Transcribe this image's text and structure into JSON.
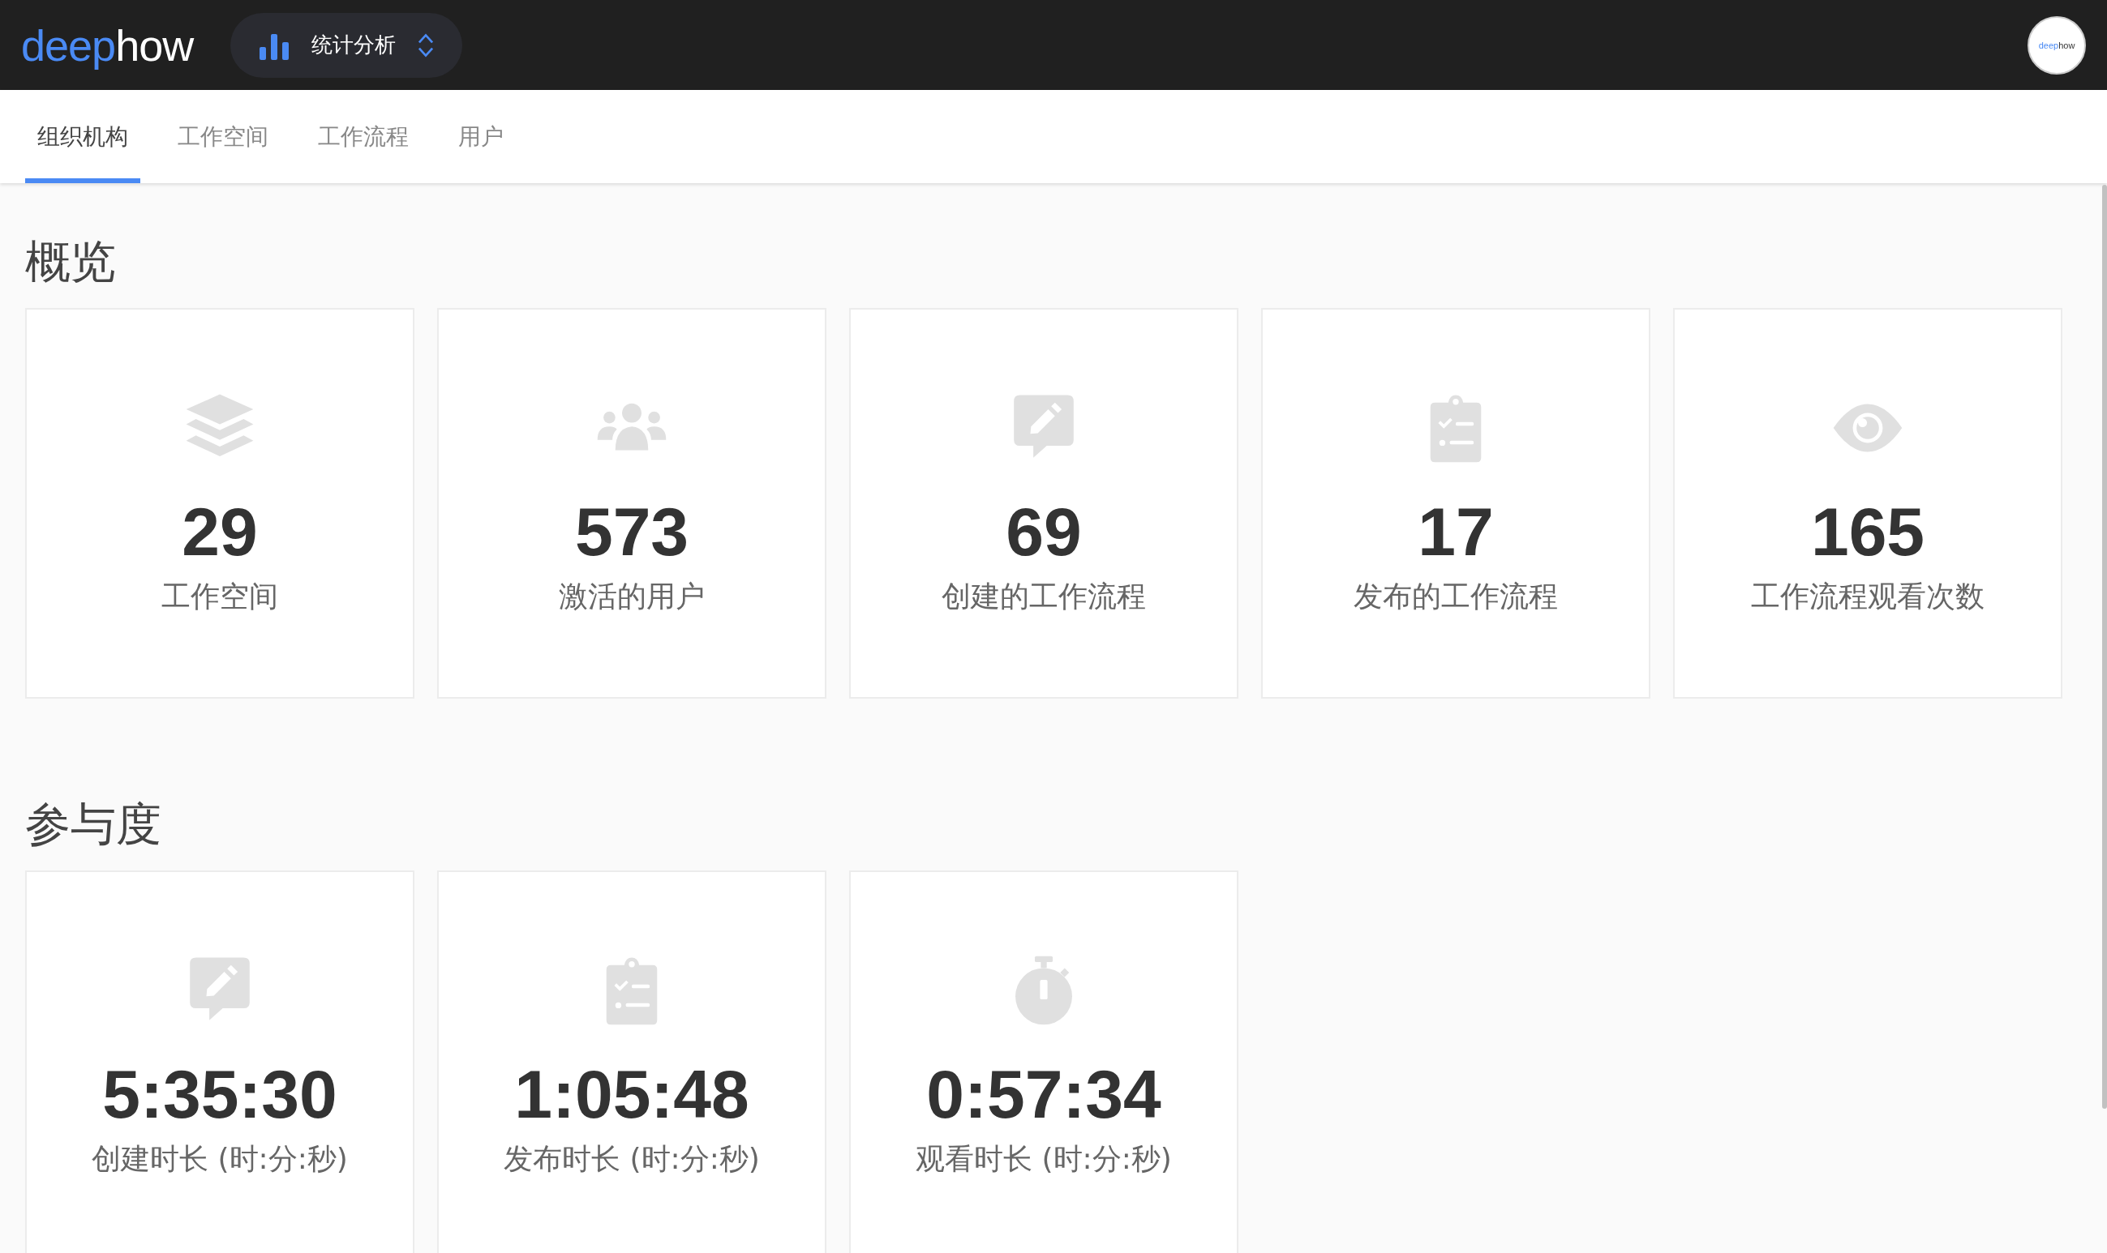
{
  "header": {
    "logo": {
      "part_1": "deep",
      "part_2": "how"
    },
    "switcher": {
      "label": "统计分析"
    },
    "avatar": {
      "part_1": "deep",
      "part_2": "how"
    }
  },
  "tabs": [
    {
      "label": "组织机构",
      "selected": true
    },
    {
      "label": "工作空间",
      "selected": false
    },
    {
      "label": "工作流程",
      "selected": false
    },
    {
      "label": "用户",
      "selected": false
    }
  ],
  "sections": [
    {
      "title": "概览",
      "cards": [
        {
          "kind": "layers",
          "value": "29",
          "label": "工作空间"
        },
        {
          "kind": "users",
          "value": "573",
          "label": "激活的用户"
        },
        {
          "kind": "edit",
          "value": "69",
          "label": "创建的工作流程"
        },
        {
          "kind": "checklist",
          "value": "17",
          "label": "发布的工作流程"
        },
        {
          "kind": "eye",
          "value": "165",
          "label": "工作流程观看次数"
        }
      ]
    },
    {
      "title": "参与度",
      "cards": [
        {
          "kind": "edit",
          "value": "5:35:30",
          "label": "创建时长 (时:分:秒)"
        },
        {
          "kind": "checklist",
          "value": "1:05:48",
          "label": "发布时长 (时:分:秒)"
        },
        {
          "kind": "stopwatch",
          "value": "0:57:34",
          "label": "观看时长 (时:分:秒)"
        }
      ]
    }
  ]
}
